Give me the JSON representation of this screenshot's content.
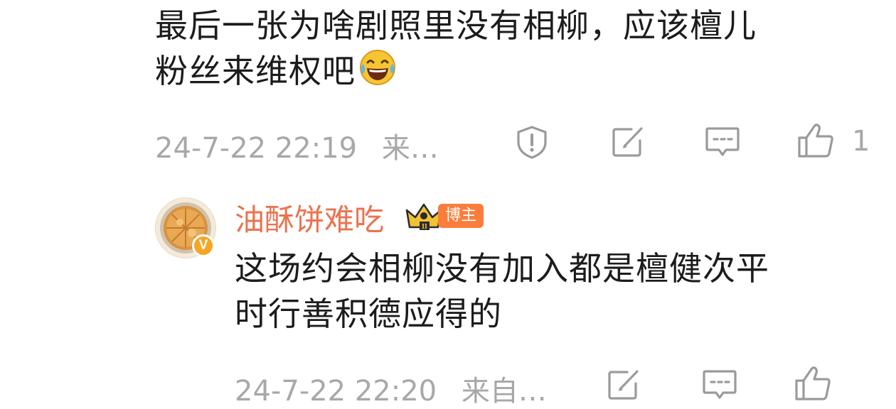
{
  "comment": {
    "text_line1": "最后一张为啥剧照里没有相柳，应该檀儿",
    "text_line2": "粉丝来维权吧",
    "emoji": "laughing-tears-emoji",
    "timestamp": "24-7-22 22:19",
    "source": "来…",
    "like_count": "1"
  },
  "reply": {
    "username": "油酥饼难吃",
    "verified_mark": "V",
    "rank_mark": "II",
    "author_tag": "博主",
    "text_line1": "这场约会相柳没有加入都是檀健次平",
    "text_line2": "时行善积德应得的",
    "timestamp": "24-7-22 22:20",
    "source": "来自…"
  },
  "colors": {
    "username": "#eb7350",
    "meta": "#a8a8a8",
    "text": "#1c1c1c",
    "author_tag_bg": "#fa7d3c",
    "verified_badge": "#f5a623"
  },
  "icons": [
    "report-icon",
    "repost-icon",
    "reply-icon",
    "like-icon",
    "verified-icon",
    "crown-icon"
  ]
}
